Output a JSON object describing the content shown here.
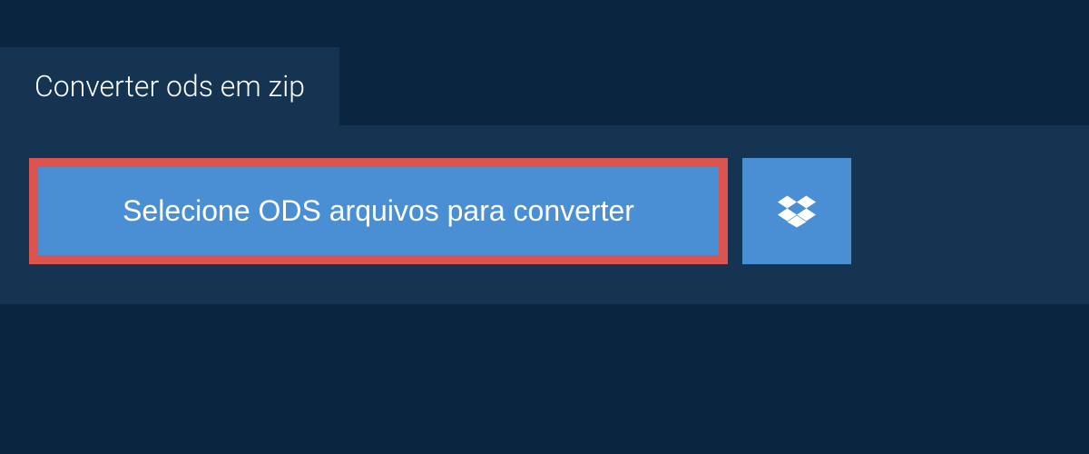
{
  "tab": {
    "label": "Converter ods em zip"
  },
  "actions": {
    "select_files_label": "Selecione ODS arquivos para converter"
  },
  "colors": {
    "background": "#0a2540",
    "panel": "#153452",
    "button": "#4a8fd4",
    "highlight_border": "#d9544f"
  }
}
